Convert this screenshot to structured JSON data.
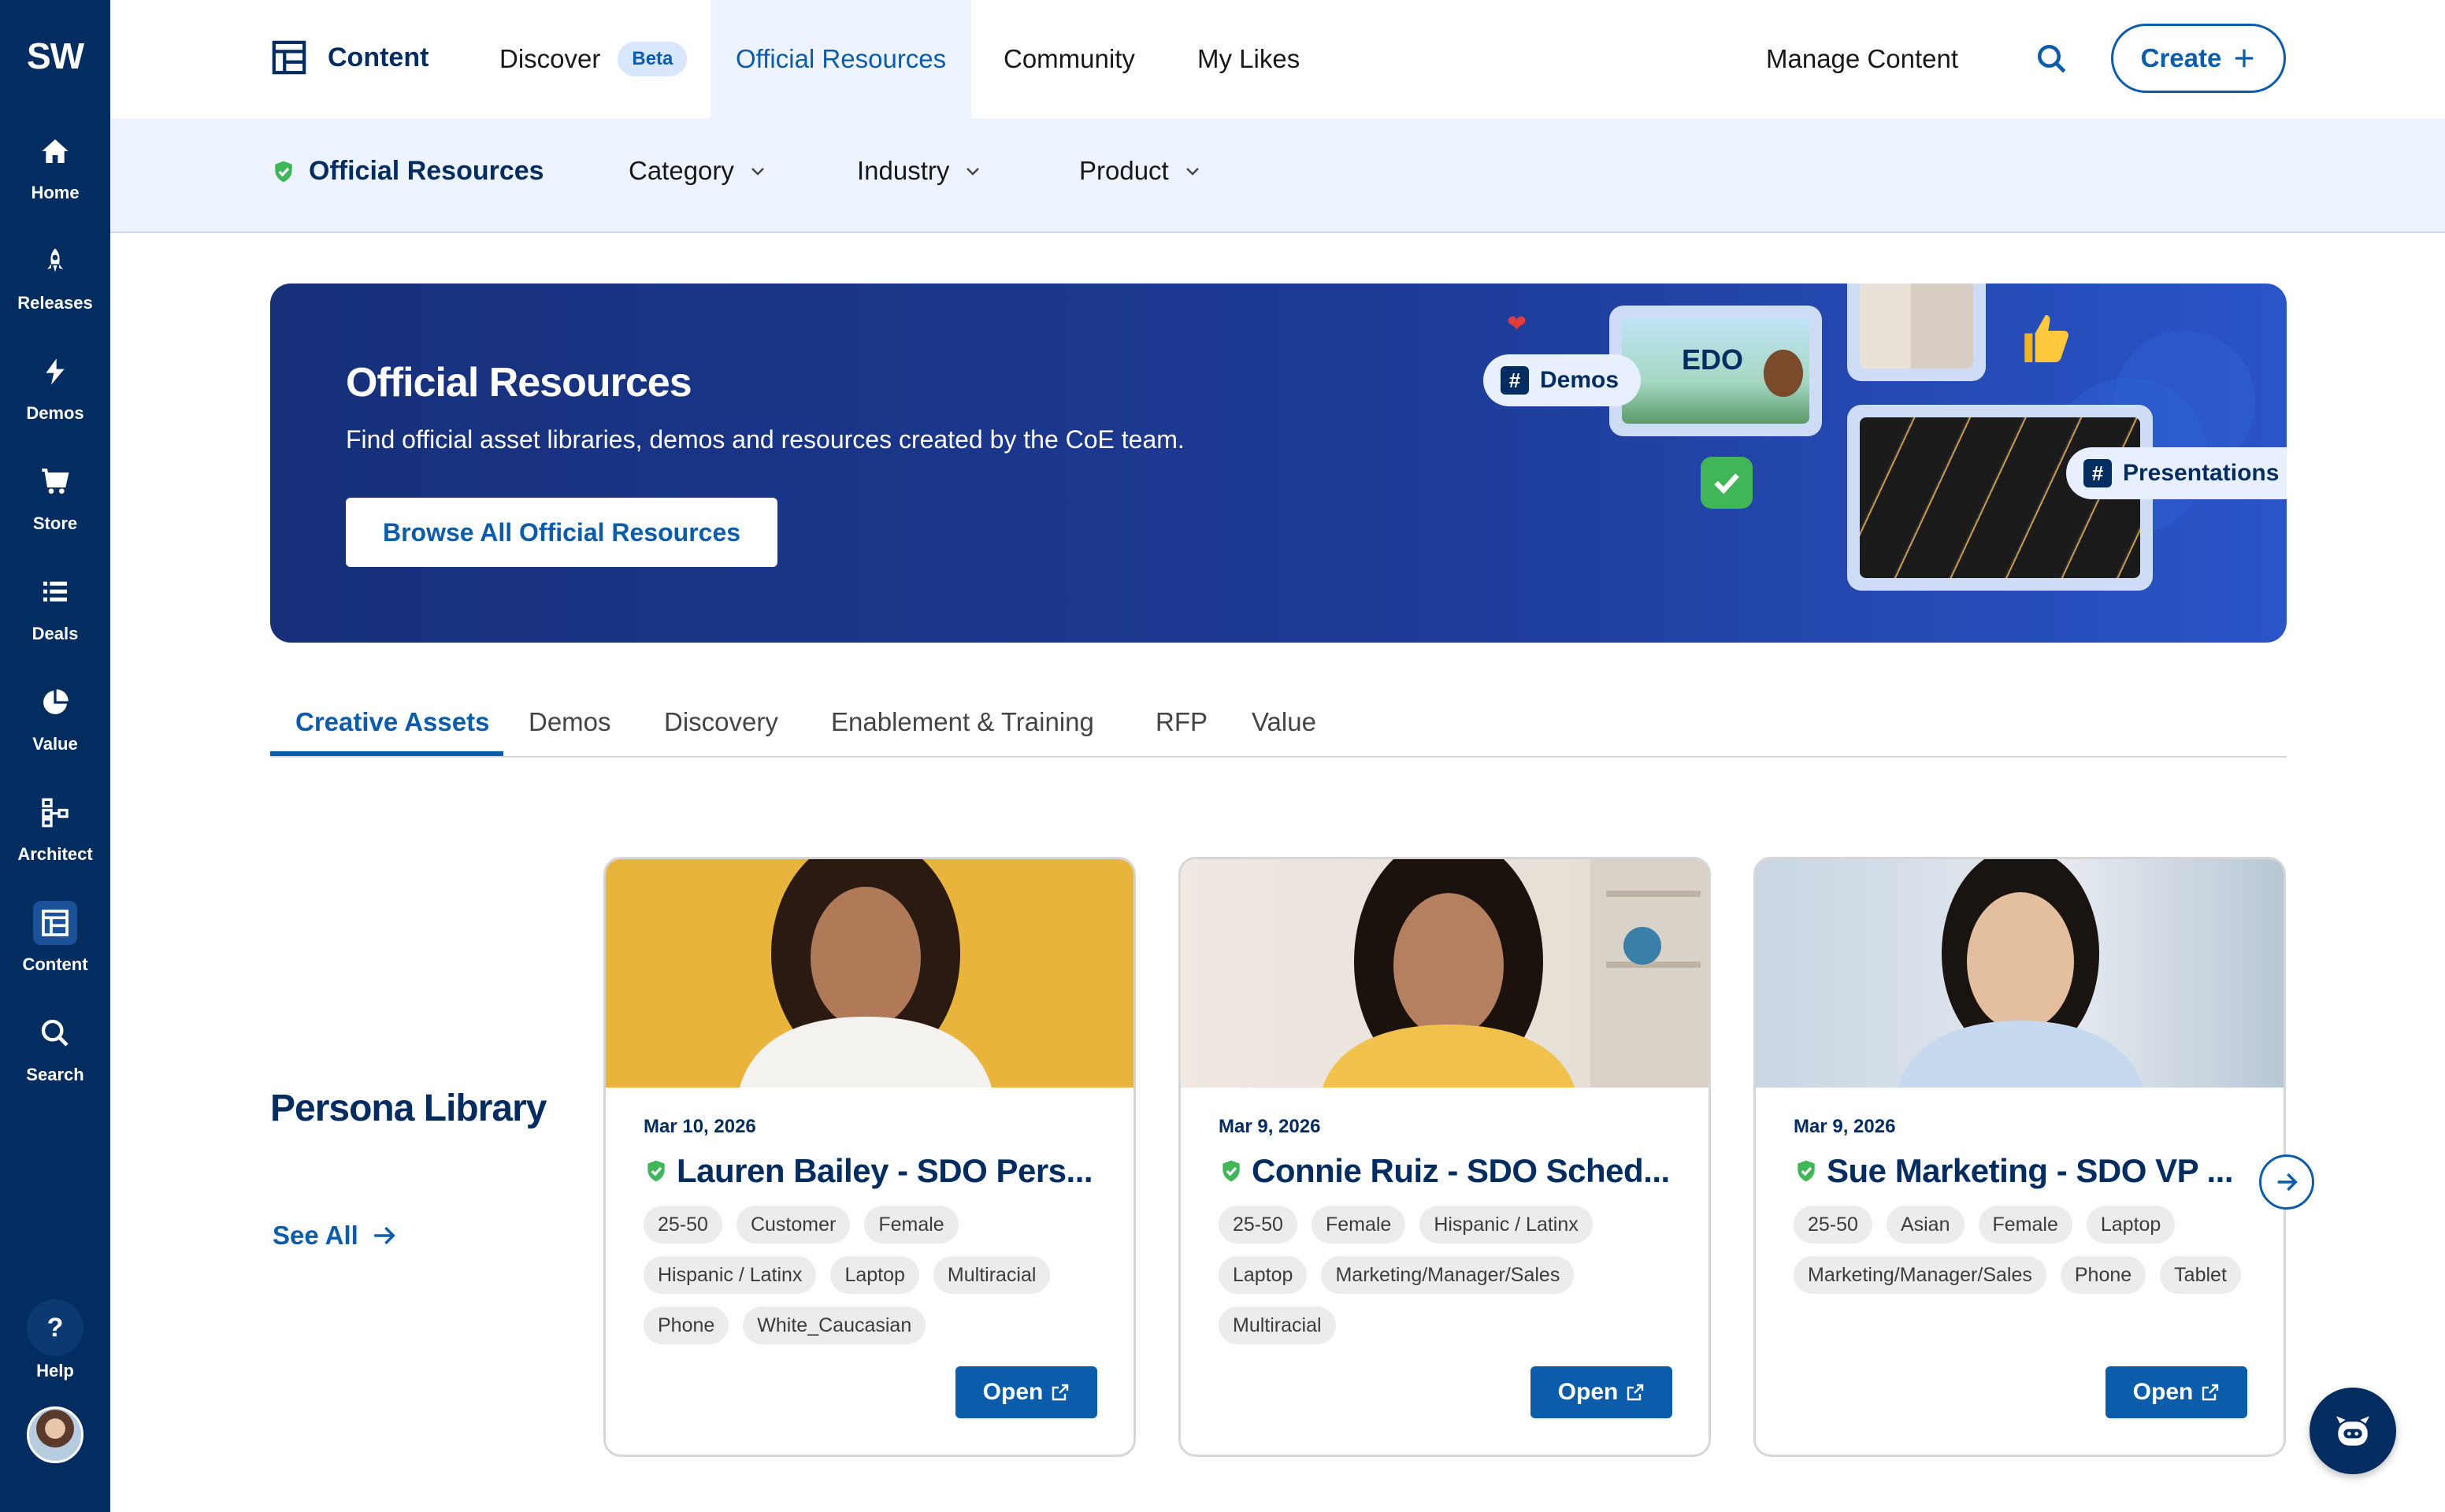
{
  "rail": {
    "logo": "SW",
    "items": [
      {
        "label": "Home",
        "icon": "home-icon"
      },
      {
        "label": "Releases",
        "icon": "rocket-icon"
      },
      {
        "label": "Demos",
        "icon": "bolt-icon"
      },
      {
        "label": "Store",
        "icon": "cart-icon"
      },
      {
        "label": "Deals",
        "icon": "list-icon"
      },
      {
        "label": "Value",
        "icon": "pie-icon"
      },
      {
        "label": "Architect",
        "icon": "hierarchy-icon"
      },
      {
        "label": "Content",
        "icon": "content-icon"
      },
      {
        "label": "Search",
        "icon": "search-icon"
      }
    ],
    "active": "Content",
    "help_label": "Help",
    "help_glyph": "?"
  },
  "topnav": {
    "brand_label": "Content",
    "links": {
      "discover": "Discover",
      "beta": "Beta",
      "official": "Official Resources",
      "community": "Community",
      "likes": "My Likes",
      "manage": "Manage Content"
    },
    "create_label": "Create"
  },
  "subnav": {
    "title": "Official Resources",
    "dropdowns": [
      "Category",
      "Industry",
      "Product"
    ]
  },
  "hero": {
    "title": "Official Resources",
    "subtitle": "Find official asset libraries, demos and resources created by the CoE team.",
    "button": "Browse All Official Resources",
    "tag_demos": "Demos",
    "tag_presentations": "Presentations",
    "edo_label": "EDO"
  },
  "tabs": [
    "Creative Assets",
    "Demos",
    "Discovery",
    "Enablement & Training",
    "RFP",
    "Value"
  ],
  "active_tab": "Creative Assets",
  "section": {
    "title": "Persona Library",
    "see_all": "See All"
  },
  "cards": [
    {
      "date": "Mar 10, 2026",
      "title": "Lauren Bailey - SDO Pers...",
      "tags": [
        "25-50",
        "Customer",
        "Female",
        "Hispanic / Latinx",
        "Laptop",
        "Multiracial",
        "Phone",
        "White_Caucasian"
      ],
      "open": "Open"
    },
    {
      "date": "Mar 9, 2026",
      "title": "Connie Ruiz - SDO Sched...",
      "tags": [
        "25-50",
        "Female",
        "Hispanic / Latinx",
        "Laptop",
        "Marketing/Manager/Sales",
        "Multiracial"
      ],
      "open": "Open"
    },
    {
      "date": "Mar 9, 2026",
      "title": "Sue Marketing - SDO VP ...",
      "tags": [
        "25-50",
        "Asian",
        "Female",
        "Laptop",
        "Marketing/Manager/Sales",
        "Phone",
        "Tablet"
      ],
      "open": "Open"
    }
  ],
  "colors": {
    "rail": "#032d60",
    "accent": "#0b5cab",
    "subnav_bg": "#eef4ff",
    "verified": "#41b658"
  }
}
